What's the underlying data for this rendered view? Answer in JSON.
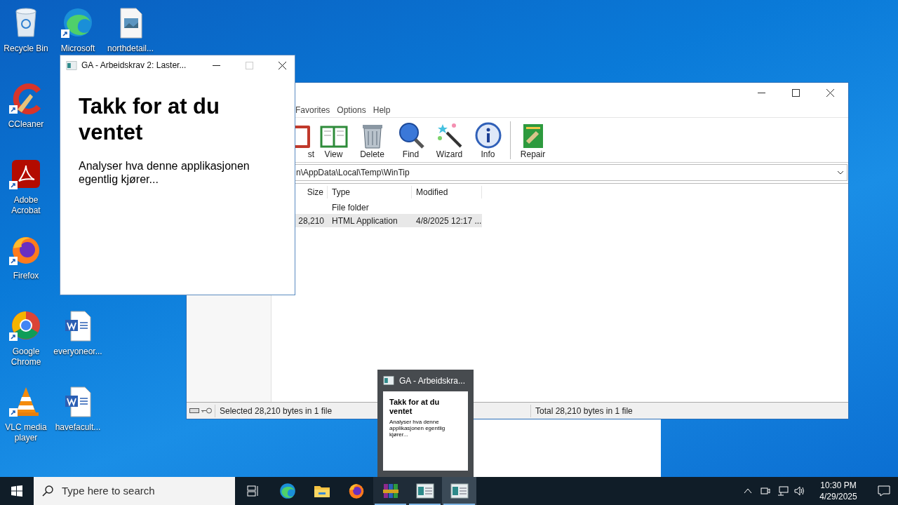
{
  "desktop_icons": [
    {
      "kind": "recycle",
      "label": "Recycle Bin",
      "shortcut": false
    },
    {
      "kind": "edge",
      "label": "Microsoft",
      "shortcut": true
    },
    {
      "kind": "image",
      "label": "northdetail...",
      "shortcut": false
    },
    {
      "kind": "ccleaner",
      "label": "CCleaner",
      "shortcut": true
    },
    {
      "kind": "acrobat",
      "label": "Adobe Acrobat",
      "shortcut": true
    },
    {
      "kind": "firefox",
      "label": "Firefox",
      "shortcut": true
    },
    {
      "kind": "chrome",
      "label": "Google Chrome",
      "shortcut": true
    },
    {
      "kind": "word",
      "label": "everyoneor...",
      "shortcut": false
    },
    {
      "kind": "vlc",
      "label": "VLC media player",
      "shortcut": true
    },
    {
      "kind": "word",
      "label": "havefacult...",
      "shortcut": false
    }
  ],
  "archiver": {
    "menu": [
      "Favorites",
      "Options",
      "Help"
    ],
    "toolbar": [
      {
        "kind": "list",
        "label": "st"
      },
      {
        "kind": "view",
        "label": "View"
      },
      {
        "kind": "delete",
        "label": "Delete"
      },
      {
        "kind": "find",
        "label": "Find"
      },
      {
        "kind": "wizard",
        "label": "Wizard"
      },
      {
        "kind": "info",
        "label": "Info"
      },
      {
        "kind": "repair",
        "label": "Repair"
      }
    ],
    "path": "n\\AppData\\Local\\Temp\\WinTip",
    "columns": [
      "Size",
      "Type",
      "Modified"
    ],
    "rows": [
      {
        "type": "File folder",
        "selected": false
      },
      {
        "size": "28,210",
        "type": "HTML Application",
        "modified": "4/8/2025 12:17 ...",
        "selected": true
      }
    ],
    "status_left": "Selected 28,210 bytes in 1 file",
    "status_right": "Total 28,210 bytes in 1 file"
  },
  "dialog": {
    "title": "GA - Arbeidskrav 2: Laster...",
    "maximize_enabled": false,
    "heading": "Takk for at du ventet",
    "text": "Analyser hva denne applikasjonen egentlig kjører..."
  },
  "thumbnail": {
    "title": "GA - Arbeidskra...",
    "heading": "Takk for at du ventet",
    "text": "Analyser hva denne applikasjonen egentlig kjører..."
  },
  "taskbar": {
    "search_placeholder": "Type here to search",
    "apps": [
      {
        "kind": "edge",
        "running": false,
        "selected": false
      },
      {
        "kind": "folder",
        "running": false,
        "selected": false
      },
      {
        "kind": "firefox",
        "running": false,
        "selected": false
      },
      {
        "kind": "archive",
        "running": true,
        "selected": false
      },
      {
        "kind": "hta",
        "running": true,
        "selected": false
      },
      {
        "kind": "hta",
        "running": true,
        "selected": true
      }
    ],
    "time": "10:30 PM",
    "date": "4/29/2025"
  }
}
